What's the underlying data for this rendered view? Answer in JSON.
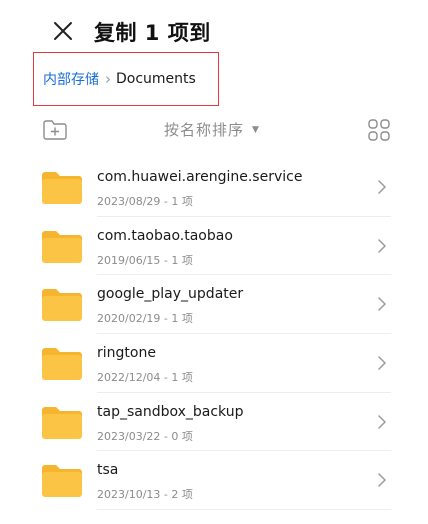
{
  "header": {
    "title": "复制 1 项到",
    "close_icon": "close-icon"
  },
  "breadcrumb": {
    "root": "内部存储",
    "separator": "›",
    "current": "Documents",
    "highlight_color": "#e0393e"
  },
  "toolbar": {
    "sort_label": "按名称排序",
    "sort_caret": "▼",
    "new_folder_icon": "new-folder-icon",
    "view_icon": "grid-view-icon"
  },
  "folders": [
    {
      "name": "com.huawei.arengine.service",
      "meta": "2023/08/29 - 1 项"
    },
    {
      "name": "com.taobao.taobao",
      "meta": "2019/06/15 - 1 项"
    },
    {
      "name": "google_play_updater",
      "meta": "2020/02/19 - 1 项"
    },
    {
      "name": "ringtone",
      "meta": "2022/12/04 - 1 项"
    },
    {
      "name": "tap_sandbox_backup",
      "meta": "2023/03/22 - 0 项"
    },
    {
      "name": "tsa",
      "meta": "2023/10/13 - 2 项"
    }
  ],
  "colors": {
    "accent": "#1a6fd6",
    "folder": "#fcc445",
    "folder_tab": "#f5b52e"
  }
}
